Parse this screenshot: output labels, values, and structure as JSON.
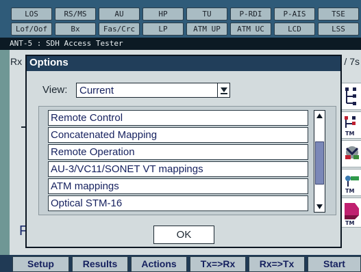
{
  "status_leds": {
    "row1": [
      "LOS",
      "RS/MS",
      "AU",
      "HP",
      "TU",
      "P-RDI",
      "P-AIS",
      "TSE"
    ],
    "row2": [
      "Lof/Oof",
      "Bx",
      "Fas/Crc",
      "LP",
      "ATM UP",
      "ATM UC",
      "LCD",
      "LSS"
    ]
  },
  "app_title": "ANT-5 : SDH Access Tester",
  "background": {
    "rx_fragment": "Rx",
    "right_fragment": "/ 7s",
    "bottom_left_fragment": "F"
  },
  "tool_icons": [
    "tree-structure-icon",
    "tm-tree-icon",
    "tool-pliers-icon",
    "tm-signal-icon",
    "tm-pink-icon"
  ],
  "tool_icon_label": "TM",
  "dialog": {
    "title": "Options",
    "view_label": "View:",
    "view_value": "Current",
    "items": [
      "Remote Control",
      "Concatenated Mapping",
      "Remote Operation",
      "AU-3/VC11/SONET VT mappings",
      "ATM mappings",
      "Optical STM-16"
    ],
    "scroll_position": 0.55,
    "ok_label": "OK"
  },
  "tabs": [
    "Setup",
    "Results",
    "Actions",
    "Tx=>Rx",
    "Rx=>Tx",
    "Start"
  ],
  "colors": {
    "status_bar": "#2f5b79",
    "titlebar": "#213e5a",
    "tab_text": "#15205e",
    "scroll_thumb": "#7b88b8"
  }
}
